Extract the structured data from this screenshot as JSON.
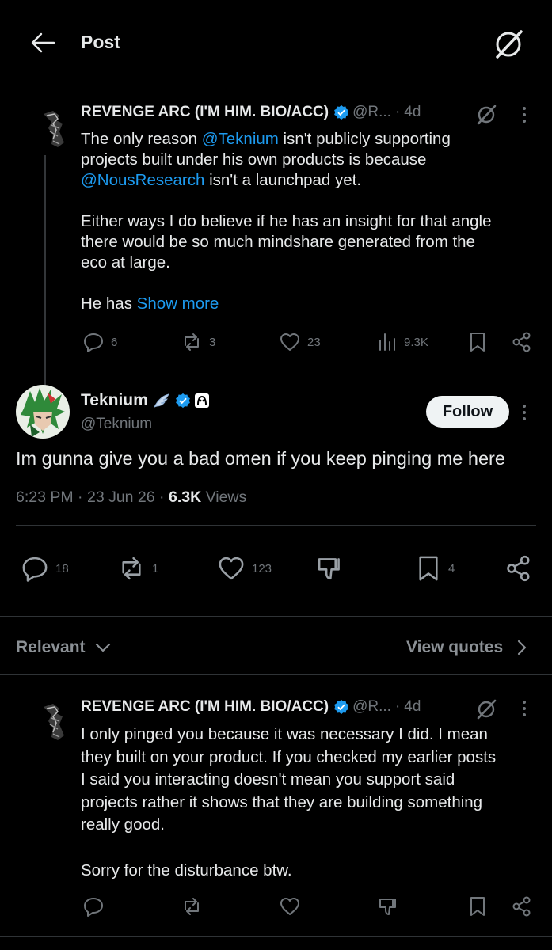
{
  "header": {
    "title": "Post",
    "back_icon": "arrow-left-icon",
    "grok_icon": "grok-icon"
  },
  "parent_reply": {
    "author_name": "REVENGE ARC (I'M HIM. BIO/ACC)",
    "handle": "@R...",
    "separator": "·",
    "age": "4d",
    "line1_pre": "The only reason ",
    "mention1": "@Teknium",
    "line1_post": " isn't publicly supporting",
    "line2": "projects built under his own products is because",
    "mention2": "@NousResearch",
    "line3_post": " isn't a launchpad yet.",
    "para2_line1": "Either ways I do believe if he has an insight for that angle",
    "para2_line2": "there would be so much mindshare generated from the",
    "para2_line3": "eco at large.",
    "para3_pre": "He has ",
    "show_more": "Show more",
    "stats": {
      "replies": "6",
      "reposts": "3",
      "likes": "23",
      "views": "9.3K"
    }
  },
  "main_post": {
    "author_name": "Teknium",
    "handle": "@Teknium",
    "follow_label": "Follow",
    "text": "Im gunna give you a bad omen if you keep pinging me here",
    "time": "6:23 PM",
    "dot": "·",
    "date": "23 Jun 26",
    "views_count": "6.3K",
    "views_label": " Views",
    "stats": {
      "replies": "18",
      "reposts": "1",
      "likes": "123",
      "bookmarks": "4"
    }
  },
  "replies_bar": {
    "sort_label": "Relevant",
    "quotes_label": "View quotes"
  },
  "reply": {
    "author_name": "REVENGE ARC (I'M HIM. BIO/ACC)",
    "handle": "@R...",
    "separator": "·",
    "age": "4d",
    "line1": "I only pinged you because it was necessary I did. I mean",
    "line2": "they built on your product. If you checked my earlier posts",
    "line3": "I said you interacting doesn't mean you support said",
    "line4": "projects rather it shows that they are building something",
    "line5": "really good.",
    "para2": "Sorry for the disturbance btw."
  },
  "colors": {
    "background": "#000000",
    "text": "#e7e9ea",
    "muted": "#71767b",
    "link": "#1d9bf0",
    "verified": "#1d9bf0",
    "follow_bg": "#eff3f4"
  }
}
